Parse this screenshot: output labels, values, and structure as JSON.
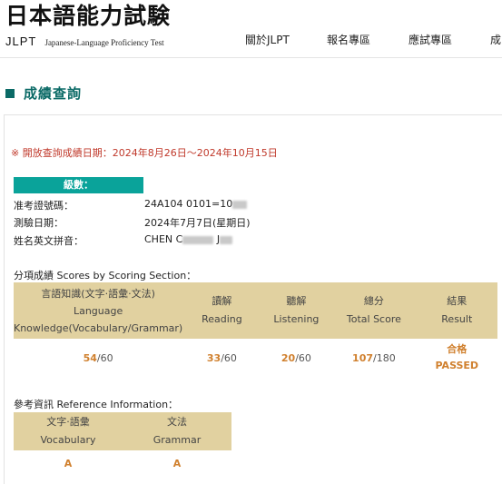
{
  "header": {
    "logo_title": "日本語能力試験",
    "logo_jlpt": "JLPT",
    "logo_tagline": "Japanese-Language Proficiency Test",
    "nav": [
      "關於JLPT",
      "報名專區",
      "應試專區",
      "成"
    ]
  },
  "page_title": "成績查詢",
  "notice": "※ 開放查詢成績日期：2024年8月26日～2024年10月15日",
  "level_label": "級數：",
  "info": {
    "exam_no_label": "准考證號碼：",
    "exam_no_value": "24A104 0101=10",
    "date_label": "測驗日期：",
    "date_value": "2024年7月7日(星期日)",
    "name_label": "姓名英文拼音：",
    "name_value_a": "CHEN C",
    "name_value_b": "J"
  },
  "scores_section": {
    "title": "分項成績 Scores by Scoring Section：",
    "headers": {
      "knowledge_zh": "言語知識(文字‧語彙‧文法)",
      "knowledge_en1": "Language",
      "knowledge_en2": "Knowledge(Vocabulary/Grammar)",
      "reading_zh": "讀解",
      "reading_en": "Reading",
      "listening_zh": "聽解",
      "listening_en": "Listening",
      "total_zh": "總分",
      "total_en": "Total Score",
      "result_zh": "結果",
      "result_en": "Result"
    },
    "knowledge_score": "54",
    "knowledge_max": "/60",
    "reading_score": "33",
    "reading_max": "/60",
    "listening_score": "20",
    "listening_max": "/60",
    "total_score": "107",
    "total_max": "/180",
    "result_zh": "合格",
    "result_en": "PASSED"
  },
  "reference_section": {
    "title": "參考資訊 Reference Information：",
    "vocab_zh": "文字‧語彙",
    "vocab_en": "Vocabulary",
    "grammar_zh": "文法",
    "grammar_en": "Grammar",
    "vocab_grade": "A",
    "grammar_grade": "A"
  },
  "colors": {
    "brand_teal": "#0b6a66",
    "level_bar": "#0aa39a",
    "table_header": "#e1d1a0",
    "score_orange": "#d0802e",
    "notice_red": "#c0392b"
  }
}
